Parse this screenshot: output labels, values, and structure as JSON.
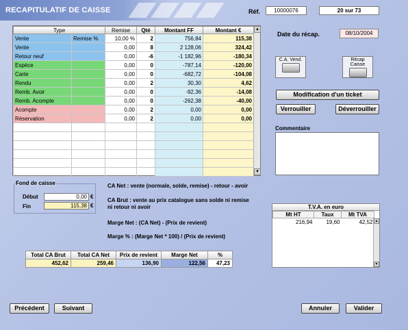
{
  "header": {
    "title": "RECAPITULATIF DE CAISSE",
    "ref_label": "Réf.",
    "ref_value": "10000076",
    "page_indicator": "20 sur 73"
  },
  "grid": {
    "headers": [
      "Type",
      "Remise",
      "Qté",
      "Montant FF",
      "Montant  €"
    ],
    "rows": [
      {
        "type": "Vente",
        "sub": "Remise %",
        "remise": "10,00 %",
        "qte": "2",
        "ff": "756,84",
        "eur": "115,38",
        "color": "blue"
      },
      {
        "type": "Vente",
        "sub": "",
        "remise": "0,00",
        "qte": "8",
        "ff": "2 128,06",
        "eur": "324,42",
        "color": "blue"
      },
      {
        "type": "Retour neuf",
        "sub": "",
        "remise": "0,00",
        "qte": "-6",
        "ff": "-1 182,96",
        "eur": "-180,34",
        "color": "blue"
      },
      {
        "type": "Espèce",
        "sub": "",
        "remise": "0,00",
        "qte": "0",
        "ff": "-787,14",
        "eur": "-120,00",
        "color": "green"
      },
      {
        "type": "Carte",
        "sub": "",
        "remise": "0,00",
        "qte": "0",
        "ff": "-682,72",
        "eur": "-104,08",
        "color": "green"
      },
      {
        "type": "Rendu",
        "sub": "",
        "remise": "0,00",
        "qte": "2",
        "ff": "30,30",
        "eur": "4,62",
        "color": "green"
      },
      {
        "type": "Remb. Avoir",
        "sub": "",
        "remise": "0,00",
        "qte": "0",
        "ff": "-92,36",
        "eur": "-14,08",
        "color": "green"
      },
      {
        "type": "Remb. Acompte",
        "sub": "",
        "remise": "0,00",
        "qte": "0",
        "ff": "-262,38",
        "eur": "-40,00",
        "color": "green"
      },
      {
        "type": "Acompte",
        "sub": "",
        "remise": "0,00",
        "qte": "2",
        "ff": "0,00",
        "eur": "0,00",
        "color": "pink"
      },
      {
        "type": "Réservation",
        "sub": "",
        "remise": "0,00",
        "qte": "2",
        "ff": "0,00",
        "eur": "0,00",
        "color": "pink"
      }
    ],
    "empty_rows": 6,
    "scroll_up": "▲",
    "scroll_down": "▼"
  },
  "right": {
    "date_label": "Date du récap.",
    "date_value": "08/10/2004",
    "ca_vend_label": "C.A. Vend.",
    "recap_caisse_label": "Récap Caisse",
    "modif_ticket": "Modification d'un ticket",
    "verrouiller": "Verrouiller",
    "deverrouiller": "Déverrouiller",
    "commentaire_label": "Commentaire",
    "commentaire_value": ""
  },
  "fond": {
    "title": "Fond de caisse",
    "debut_label": "Début",
    "debut_value": "0,00",
    "fin_label": "Fin",
    "fin_value": "115,38",
    "currency": "€"
  },
  "info": {
    "ca_net": "CA Net : vente (normale, solde, remise) - retour - avoir",
    "ca_brut_1": "CA Brut : vente au prix catalogue sans solde ni remise",
    "ca_brut_2": "ni retour ni avoir",
    "marge_net": "Marge Net : (CA Net) - (Prix de revient)",
    "marge_pct": "Marge % : (Marge Net * 100) / (Prix de revient)"
  },
  "tva": {
    "title": "T.V.A. en euro",
    "headers": [
      "Mt HT",
      "Taux",
      "Mt TVA"
    ],
    "rows": [
      {
        "ht": "216,94",
        "taux": "19,60",
        "tva": "42,52"
      }
    ]
  },
  "totals": {
    "headers": [
      "Total CA Brut",
      "Total CA Net",
      "Prix de revient",
      "Marge Net",
      "%"
    ],
    "values": [
      "452,62",
      "259,46",
      "136,90",
      "122,56",
      "47,23"
    ]
  },
  "footer": {
    "precedent": "Précédent",
    "suivant": "Suivant",
    "annuler": "Annuler",
    "valider": "Valider"
  },
  "colors": {
    "blue": "#8cc3ee",
    "green": "#78d878",
    "pink": "#f4b9b9",
    "ff_col": "#d4eef8",
    "eur_col": "#fcf6c8"
  }
}
